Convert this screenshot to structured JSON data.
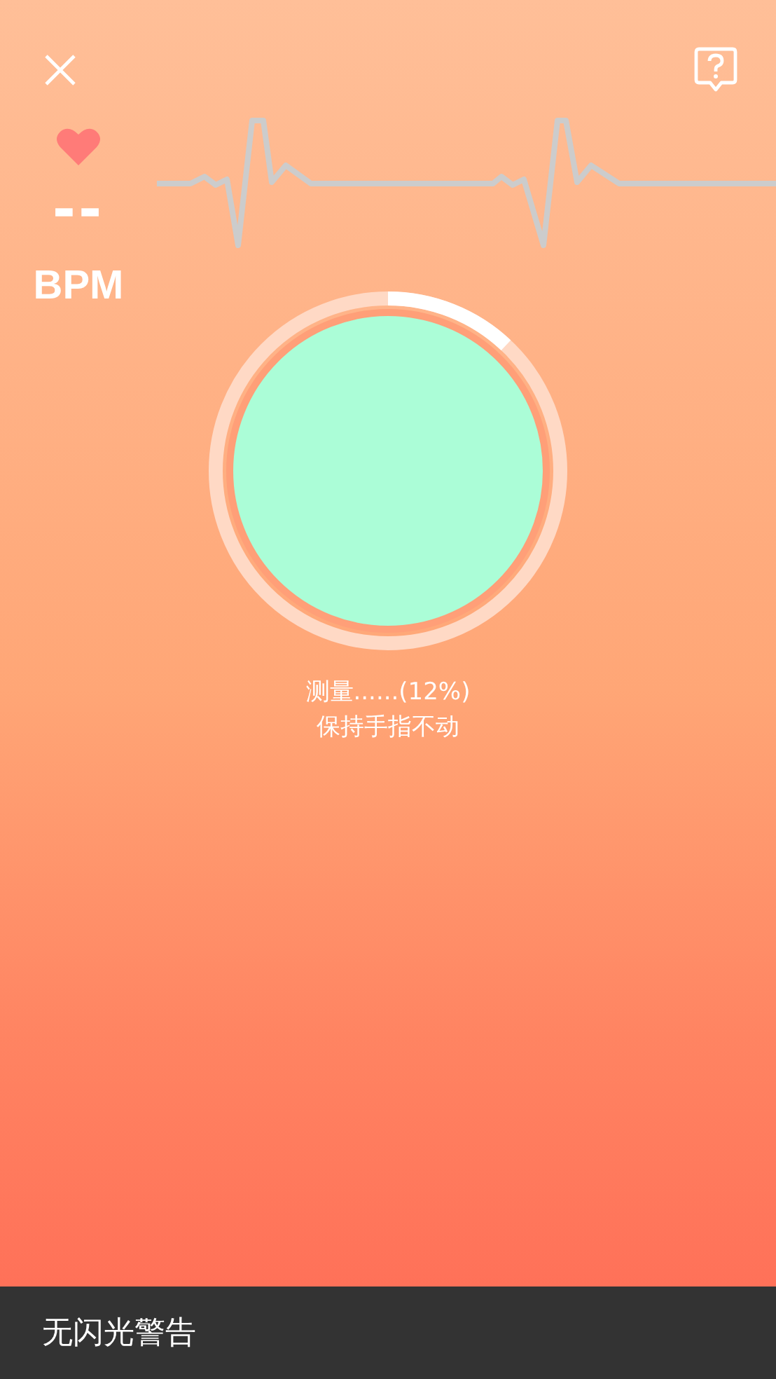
{
  "reading": {
    "value": "--",
    "unit": "BPM"
  },
  "progress": {
    "level": 0.12,
    "status": "测量......(12%)",
    "hint": "保持手指不动"
  },
  "toast": {
    "message": "无闪光警告"
  }
}
